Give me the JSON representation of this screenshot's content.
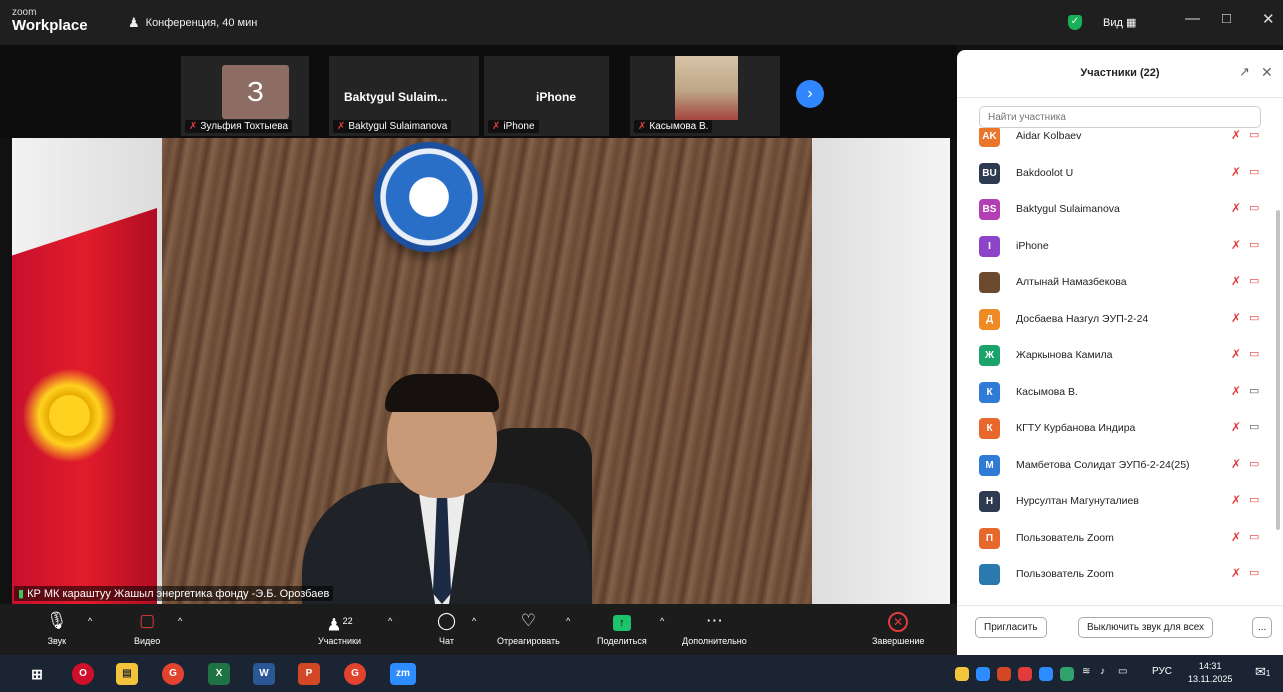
{
  "titlebar": {
    "logo_top": "zoom",
    "logo_bottom": "Workplace",
    "meeting_title": "Конференция, 40 мин",
    "view_label": "Вид",
    "window_controls": [
      "minimize-icon",
      "maximize-icon",
      "close-icon"
    ]
  },
  "gallery": {
    "tiles": [
      {
        "big": "З",
        "name": "Зульфия Тохтыева"
      },
      {
        "big": "Baktygul Sulaim...",
        "name": "Baktygul Sulaimanova"
      },
      {
        "big": "iPhone",
        "name": "iPhone"
      },
      {
        "big": "",
        "name": "Касымова В."
      }
    ]
  },
  "video": {
    "speaker_label": "КР МК караштуу Жашыл энергетика фонду -Э.Б. Орозбаев"
  },
  "toolbar": {
    "audio": "Звук",
    "video": "Видео",
    "participants": "Участники",
    "participants_count": "22",
    "chat": "Чат",
    "react": "Отреагировать",
    "share": "Поделиться",
    "more": "Дополнительно",
    "end": "Завершение"
  },
  "panel": {
    "title": "Участники (22)",
    "search_placeholder": "Найти участника",
    "participants": [
      {
        "initials": "AK",
        "name": "Aidar Kolbaev",
        "color": "#e8762b",
        "cam": "off"
      },
      {
        "initials": "BU",
        "name": "Bakdoolot U",
        "color": "#2e3a4f",
        "cam": "off"
      },
      {
        "initials": "BS",
        "name": "Baktygul Sulaimanova",
        "color": "#b23fb3",
        "cam": "off"
      },
      {
        "initials": "I",
        "name": "iPhone",
        "color": "#8e44c8",
        "cam": "off"
      },
      {
        "initials": "",
        "name": "Алтынай Намазбекова",
        "color": "#6b4a2e",
        "cam": "off"
      },
      {
        "initials": "Д",
        "name": "Досбаева Назгул ЭУП-2-24",
        "color": "#f08a24",
        "cam": "off"
      },
      {
        "initials": "Ж",
        "name": "Жаркынова Камила",
        "color": "#1aa36b",
        "cam": "off"
      },
      {
        "initials": "К",
        "name": "Касымова В.",
        "color": "#2f7bd6",
        "cam": "on"
      },
      {
        "initials": "К",
        "name": "КГТУ Курбанова Индира",
        "color": "#e8672b",
        "cam": "on"
      },
      {
        "initials": "М",
        "name": "Мамбетова Солидат ЭУПб-2-24(25)",
        "color": "#2f7bd6",
        "cam": "off"
      },
      {
        "initials": "Н",
        "name": "Нурсултан Магунуталиев",
        "color": "#2e3a4f",
        "cam": "off"
      },
      {
        "initials": "П",
        "name": "Пользователь Zoom",
        "color": "#e8672b",
        "cam": "off"
      },
      {
        "initials": "",
        "name": "Пользователь Zoom",
        "color": "#2a7ab0",
        "cam": "off"
      }
    ],
    "invite": "Пригласить",
    "mute_all": "Выключить звук для всех",
    "more": "..."
  },
  "taskbar": {
    "apps": [
      "windows-start",
      "opera",
      "file-explorer",
      "chrome",
      "excel",
      "word",
      "powerpoint",
      "chrome",
      "zoom"
    ],
    "lang": "РУС",
    "time": "14:31",
    "date": "13.11.2025",
    "notif_count": "1"
  }
}
